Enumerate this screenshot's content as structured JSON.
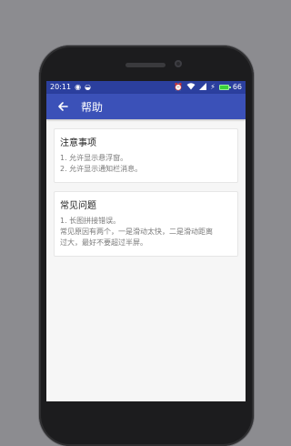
{
  "status_bar": {
    "time": "20:11",
    "left_icons": [
      "weibo-icon",
      "cloud-icon"
    ],
    "right_icons": [
      "alarm-icon",
      "wifi-icon",
      "signal-icon",
      "charging-icon"
    ],
    "battery": "66",
    "battery_color": "#3ad13a"
  },
  "app_bar": {
    "title": "帮助",
    "color": "#3b51b8"
  },
  "cards": [
    {
      "title": "注意事项",
      "lines": [
        "1. 允许显示悬浮窗。",
        "2. 允许显示通知栏消息。"
      ]
    },
    {
      "title": "常见问题",
      "lines": [
        "1. 长图拼接错误。",
        "常见原因有两个，一是滑动太快，二是滑动距离",
        "过大，最好不要超过半屏。"
      ]
    }
  ]
}
